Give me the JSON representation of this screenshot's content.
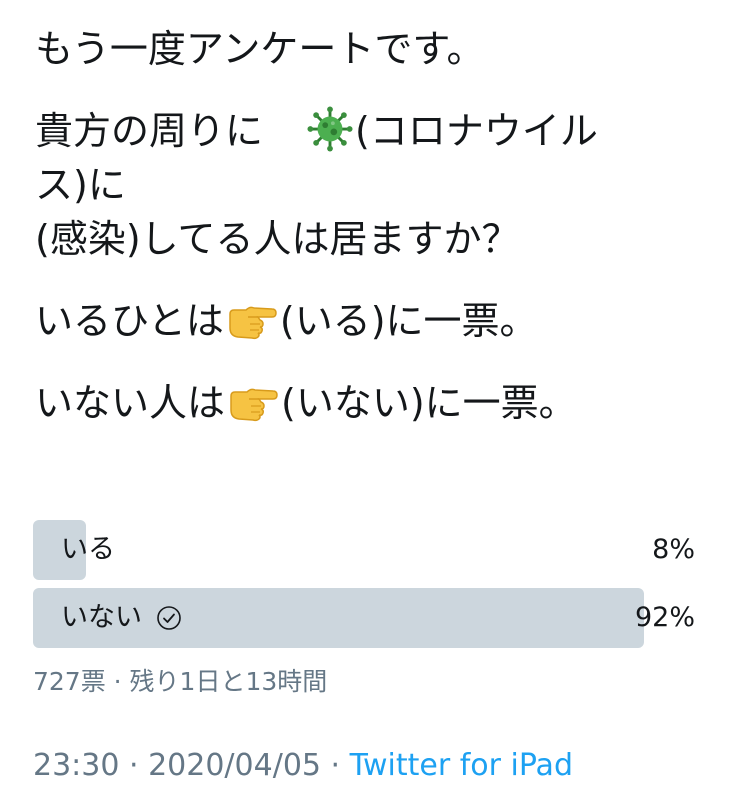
{
  "tweet": {
    "line1": "もう一度アンケートです。",
    "line2_before": "貴方の周りに",
    "line2_after": "(コロナウイル",
    "line3": "ス)に",
    "line4": "(感染)してる人は居ますか？",
    "line5_before": "いるひとは",
    "line5_after": "(いる)に一票。",
    "line6_before": "いない人は",
    "line6_after": "(いない)に一票。",
    "icons": [
      "virus-icon",
      "pointing-right-icon"
    ]
  },
  "poll": {
    "options": [
      {
        "label": "いる",
        "percent_text": "8%",
        "percent": 8,
        "winner": false
      },
      {
        "label": "いない",
        "percent_text": "92%",
        "percent": 92,
        "winner": true
      }
    ],
    "meta": "727票 · 残り1日と13時間",
    "bar_color": "#ccd6dd"
  },
  "footer": {
    "time": "23:30",
    "separator": " · ",
    "date": "2020/04/05",
    "source": "Twitter for iPad",
    "link_color": "#1da1f2",
    "muted_color": "#657786"
  }
}
